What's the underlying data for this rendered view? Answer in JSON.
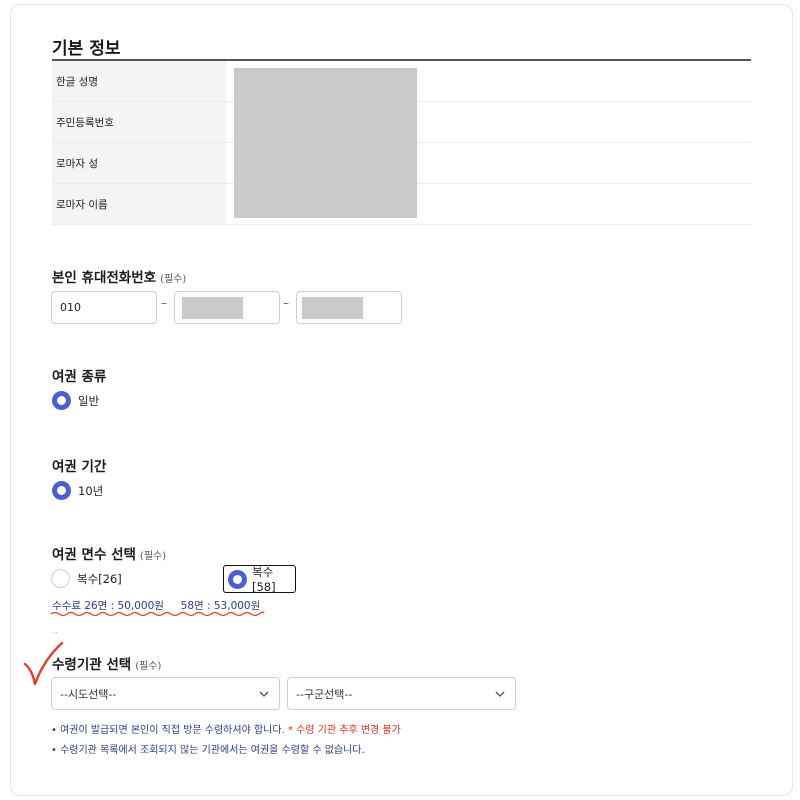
{
  "basic_info": {
    "title": "기본 정보",
    "rows": [
      {
        "label": "한글 성명"
      },
      {
        "label": "주민등록번호"
      },
      {
        "label": "로마자 성"
      },
      {
        "label": "로마자 이름"
      }
    ]
  },
  "phone": {
    "label": "본인 휴대전화번호",
    "required": "(필수)",
    "first": "010",
    "separator": "–"
  },
  "passport_type": {
    "label": "여권 종류",
    "option": "일반"
  },
  "passport_period": {
    "label": "여권 기간",
    "option": "10년"
  },
  "page_count": {
    "label": "여권 면수 선택",
    "required": "(필수)",
    "options": [
      {
        "label": "복수[26]",
        "selected": false
      },
      {
        "label": "복수[58]",
        "selected": true
      }
    ],
    "fee_text": "수수료 26면 : 50,000원     58면 : 53,000원"
  },
  "misc": {
    "tiny_dots": "..",
    "annotation_color": "#e0402a"
  },
  "pickup": {
    "label": "수령기관 선택",
    "required": "(필수)",
    "province_select": "--시도선택--",
    "district_select": "--구군선택--"
  },
  "notes": {
    "line1": "• 여권이 발급되면 본인이 직접 방문 수령하셔야 합니다.",
    "line1_warn": "* 수령 기관 추후 변경 불가",
    "line2": "• 수령기관 목록에서 조회되지 않는 기관에서는 여권을 수령할 수 없습니다."
  },
  "colors": {
    "accent": "#4a5fd6",
    "note_text": "#2f3c8a",
    "warning": "#d93025",
    "redaction": "#cacaca"
  }
}
